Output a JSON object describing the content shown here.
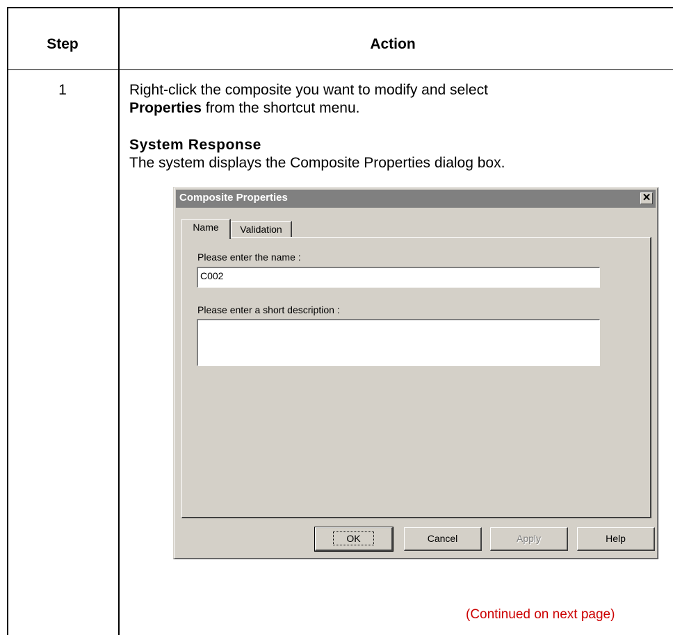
{
  "table": {
    "header_step": "Step",
    "header_action": "Action",
    "step_number": "1",
    "instruction_pre": "Right-click the composite you want to modify and select",
    "instruction_bold": "Properties",
    "instruction_post": " from the shortcut menu.",
    "system_response_heading": "System Response",
    "system_response_text": "The system displays the Composite Properties dialog box.",
    "continued": "(Continued on next page)"
  },
  "dialog": {
    "title": "Composite Properties",
    "close_glyph": "✕",
    "tabs": [
      {
        "label": "Name",
        "active": true
      },
      {
        "label": "Validation",
        "active": false
      }
    ],
    "name_label": "Please enter the name :",
    "name_value": "C002",
    "description_label": "Please enter a short description :",
    "description_value": "",
    "buttons": {
      "ok": "OK",
      "cancel": "Cancel",
      "apply": "Apply",
      "help": "Help"
    }
  },
  "colors": {
    "continued_text": "#cc0000",
    "dialog_face": "#d4d0c8",
    "titlebar": "#808080"
  }
}
